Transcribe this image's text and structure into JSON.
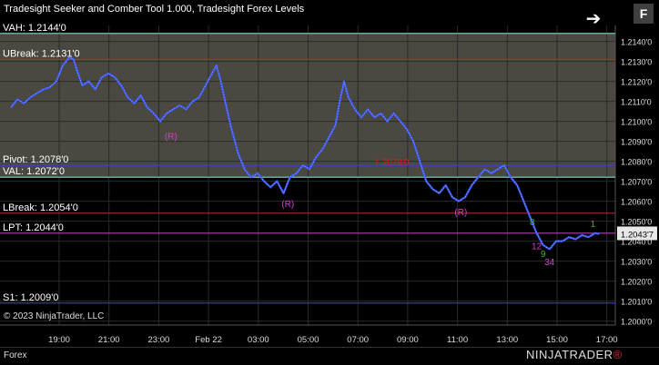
{
  "window": {
    "title": "Tradesight Seeker and Comber Tool 1.000, Tradesight Forex Levels",
    "nav_icon": "arrow-right-icon",
    "f_button": "F",
    "copyright": "© 2023 NinjaTrader, LLC",
    "tab": "Forex",
    "logo_text": "NINJATRADER",
    "logo_mark": "®"
  },
  "chart_data": {
    "type": "line",
    "x_ticks": [
      "19:00",
      "21:00",
      "23:00",
      "Feb 22",
      "03:00",
      "05:00",
      "07:00",
      "09:00",
      "11:00",
      "13:00",
      "15:00",
      "17:00"
    ],
    "y_ticks": [
      "1.2140'0",
      "1.2130'0",
      "1.2120'0",
      "1.2110'0",
      "1.2100'0",
      "1.2090'0",
      "1.2080'0",
      "1.2070'0",
      "1.2060'0",
      "1.2050'0",
      "1.2040'0",
      "1.2030'0",
      "1.2020'0",
      "1.2010'0",
      "1.2000'0"
    ],
    "ylim": [
      1.1998,
      1.2148
    ],
    "last_price": "1.2043'7",
    "levels": [
      {
        "label": "VAH: 1.2144'0",
        "value": 1.2144,
        "color": "#7fd8d0"
      },
      {
        "label": "UBreak: 1.2131'0",
        "value": 1.2131,
        "color": "#b02828"
      },
      {
        "label": "Pivot: 1.2078'0",
        "value": 1.2078,
        "color": "#3a3adf"
      },
      {
        "label": "VAL: 1.2072'0",
        "value": 1.2072,
        "color": "#7fd8d0"
      },
      {
        "label": "LBreak: 1.2054'0",
        "value": 1.2054,
        "color": "#b02828"
      },
      {
        "label": "LPT: 1.2044'0",
        "value": 1.2044,
        "color": "#b040b0"
      },
      {
        "label": "S1: 1.2009'0",
        "value": 1.2009,
        "color": "#3a3adf"
      }
    ],
    "price_series": [
      [
        0.0,
        1.2107
      ],
      [
        0.3,
        1.2111
      ],
      [
        0.6,
        1.2109
      ],
      [
        0.9,
        1.2112
      ],
      [
        1.2,
        1.2114
      ],
      [
        1.5,
        1.2116
      ],
      [
        1.8,
        1.2117
      ],
      [
        2.1,
        1.212
      ],
      [
        2.4,
        1.2128
      ],
      [
        2.7,
        1.2132
      ],
      [
        2.9,
        1.2131
      ],
      [
        3.1,
        1.2124
      ],
      [
        3.3,
        1.2118
      ],
      [
        3.6,
        1.212
      ],
      [
        3.9,
        1.2116
      ],
      [
        4.2,
        1.2122
      ],
      [
        4.5,
        1.2124
      ],
      [
        4.8,
        1.2122
      ],
      [
        5.1,
        1.2118
      ],
      [
        5.4,
        1.2112
      ],
      [
        5.7,
        1.2109
      ],
      [
        6.0,
        1.2113
      ],
      [
        6.3,
        1.2107
      ],
      [
        6.6,
        1.2104
      ],
      [
        6.9,
        1.21
      ],
      [
        7.2,
        1.2104
      ],
      [
        7.5,
        1.2106
      ],
      [
        7.8,
        1.2108
      ],
      [
        8.1,
        1.2106
      ],
      [
        8.4,
        1.211
      ],
      [
        8.7,
        1.2112
      ],
      [
        9.0,
        1.2118
      ],
      [
        9.3,
        1.2124
      ],
      [
        9.5,
        1.2128
      ],
      [
        9.7,
        1.212
      ],
      [
        9.9,
        1.211
      ],
      [
        10.2,
        1.2096
      ],
      [
        10.5,
        1.2084
      ],
      [
        10.8,
        1.2076
      ],
      [
        11.1,
        1.2072
      ],
      [
        11.4,
        1.2074
      ],
      [
        11.7,
        1.207
      ],
      [
        12.0,
        1.2067
      ],
      [
        12.3,
        1.207
      ],
      [
        12.6,
        1.2064
      ],
      [
        12.9,
        1.2072
      ],
      [
        13.2,
        1.2074
      ],
      [
        13.5,
        1.2078
      ],
      [
        13.8,
        1.2076
      ],
      [
        14.1,
        1.2082
      ],
      [
        14.4,
        1.2086
      ],
      [
        14.7,
        1.2092
      ],
      [
        15.0,
        1.2098
      ],
      [
        15.2,
        1.211
      ],
      [
        15.4,
        1.212
      ],
      [
        15.6,
        1.2112
      ],
      [
        15.9,
        1.2106
      ],
      [
        16.2,
        1.2102
      ],
      [
        16.5,
        1.2106
      ],
      [
        16.8,
        1.2102
      ],
      [
        17.1,
        1.2104
      ],
      [
        17.4,
        1.21
      ],
      [
        17.7,
        1.2104
      ],
      [
        18.0,
        1.21
      ],
      [
        18.3,
        1.2096
      ],
      [
        18.6,
        1.209
      ],
      [
        18.9,
        1.208
      ],
      [
        19.2,
        1.207
      ],
      [
        19.5,
        1.2066
      ],
      [
        19.8,
        1.2064
      ],
      [
        20.1,
        1.2068
      ],
      [
        20.4,
        1.2062
      ],
      [
        20.7,
        1.206
      ],
      [
        21.0,
        1.2062
      ],
      [
        21.3,
        1.2068
      ],
      [
        21.6,
        1.2072
      ],
      [
        21.9,
        1.2076
      ],
      [
        22.2,
        1.2074
      ],
      [
        22.5,
        1.2076
      ],
      [
        22.8,
        1.2078
      ],
      [
        23.1,
        1.2072
      ],
      [
        23.4,
        1.2068
      ],
      [
        23.7,
        1.206
      ],
      [
        24.0,
        1.2052
      ],
      [
        24.3,
        1.2044
      ],
      [
        24.6,
        1.2038
      ],
      [
        24.9,
        1.2036
      ],
      [
        25.2,
        1.204
      ],
      [
        25.5,
        1.204
      ],
      [
        25.8,
        1.2042
      ],
      [
        26.1,
        1.2041
      ],
      [
        26.4,
        1.2043
      ],
      [
        26.7,
        1.2042
      ],
      [
        27.0,
        1.2044
      ],
      [
        27.2,
        1.20437
      ]
    ],
    "annotations": [
      {
        "text": "(R)",
        "x": 7.4,
        "y": 1.2091,
        "color": "#d040d0"
      },
      {
        "text": "(R)",
        "x": 12.8,
        "y": 1.2057,
        "color": "#d040d0"
      },
      {
        "text": "(R)",
        "x": 20.8,
        "y": 1.2053,
        "color": "#d040d0"
      },
      {
        "text": "1.2078'0",
        "x": 17.6,
        "y": 1.2078,
        "color": "#d02020"
      },
      {
        "text": "12",
        "x": 24.3,
        "y": 1.2036,
        "color": "#d040d0"
      },
      {
        "text": "34",
        "x": 24.9,
        "y": 1.2028,
        "color": "#d040d0"
      },
      {
        "text": "8",
        "x": 24.1,
        "y": 1.2048,
        "color": "#3cb43c"
      },
      {
        "text": "9",
        "x": 24.6,
        "y": 1.2032,
        "color": "#3cb43c"
      },
      {
        "text": "1",
        "x": 26.9,
        "y": 1.2047,
        "color": "#3cb43c"
      }
    ],
    "xlabel": "",
    "ylabel": ""
  }
}
